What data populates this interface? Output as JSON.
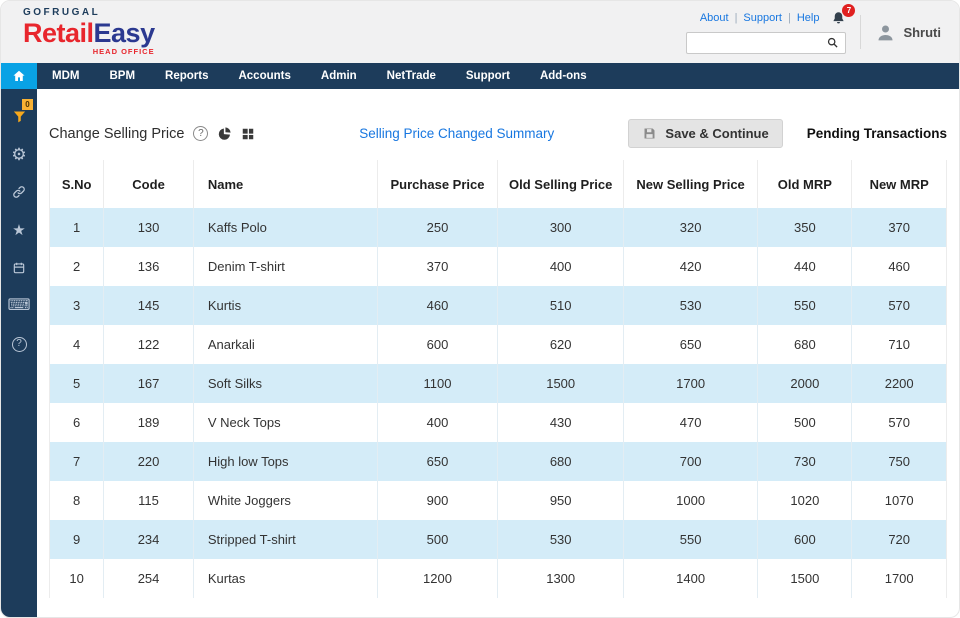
{
  "header": {
    "brand_top": "GOFRUGAL",
    "brand_red": "Retail",
    "brand_blue": "Easy",
    "brand_sub": "HEAD OFFICE",
    "links": [
      "About",
      "Support",
      "Help"
    ],
    "link_separator": "|",
    "notification_badge": "7",
    "user_name": "Shruti"
  },
  "nav": {
    "items": [
      "MDM",
      "BPM",
      "Reports",
      "Accounts",
      "Admin",
      "NetTrade",
      "Support",
      "Add-ons"
    ]
  },
  "sidebar": {
    "filter_badge": "0"
  },
  "icons": {
    "gear": "⚙",
    "star": "★",
    "keyboard": "⌨",
    "help": "?",
    "title_help": "?"
  },
  "toolbar": {
    "title": "Change Selling Price",
    "summary_link": "Selling Price Changed Summary",
    "save_label": "Save & Continue",
    "pending_label": "Pending Transactions"
  },
  "table": {
    "headers": [
      "S.No",
      "Code",
      "Name",
      "Purchase Price",
      "Old Selling Price",
      "New Selling Price",
      "Old MRP",
      "New MRP"
    ],
    "rows": [
      [
        "1",
        "130",
        "Kaffs Polo",
        "250",
        "300",
        "320",
        "350",
        "370"
      ],
      [
        "2",
        "136",
        "Denim T-shirt",
        "370",
        "400",
        "420",
        "440",
        "460"
      ],
      [
        "3",
        "145",
        "Kurtis",
        "460",
        "510",
        "530",
        "550",
        "570"
      ],
      [
        "4",
        "122",
        "Anarkali",
        "600",
        "620",
        "650",
        "680",
        "710"
      ],
      [
        "5",
        "167",
        "Soft Silks",
        "1100",
        "1500",
        "1700",
        "2000",
        "2200"
      ],
      [
        "6",
        "189",
        "V Neck Tops",
        "400",
        "430",
        "470",
        "500",
        "570"
      ],
      [
        "7",
        "220",
        "High low Tops",
        "650",
        "680",
        "700",
        "730",
        "750"
      ],
      [
        "8",
        "115",
        "White Joggers",
        "900",
        "950",
        "1000",
        "1020",
        "1070"
      ],
      [
        "9",
        "234",
        "Stripped T-shirt",
        "500",
        "530",
        "550",
        "600",
        "720"
      ],
      [
        "10",
        "254",
        "Kurtas",
        "1200",
        "1300",
        "1400",
        "1500",
        "1700"
      ]
    ]
  },
  "colors": {
    "nav_bg": "#1d3c5b",
    "home_accent": "#09a2e5",
    "row_stripe": "#d4ecf8",
    "link_blue": "#1877e0",
    "brand_red": "#e8262d",
    "brand_navy": "#2b3990",
    "badge_red": "#e02020",
    "filter_orange": "#f6a81c"
  }
}
